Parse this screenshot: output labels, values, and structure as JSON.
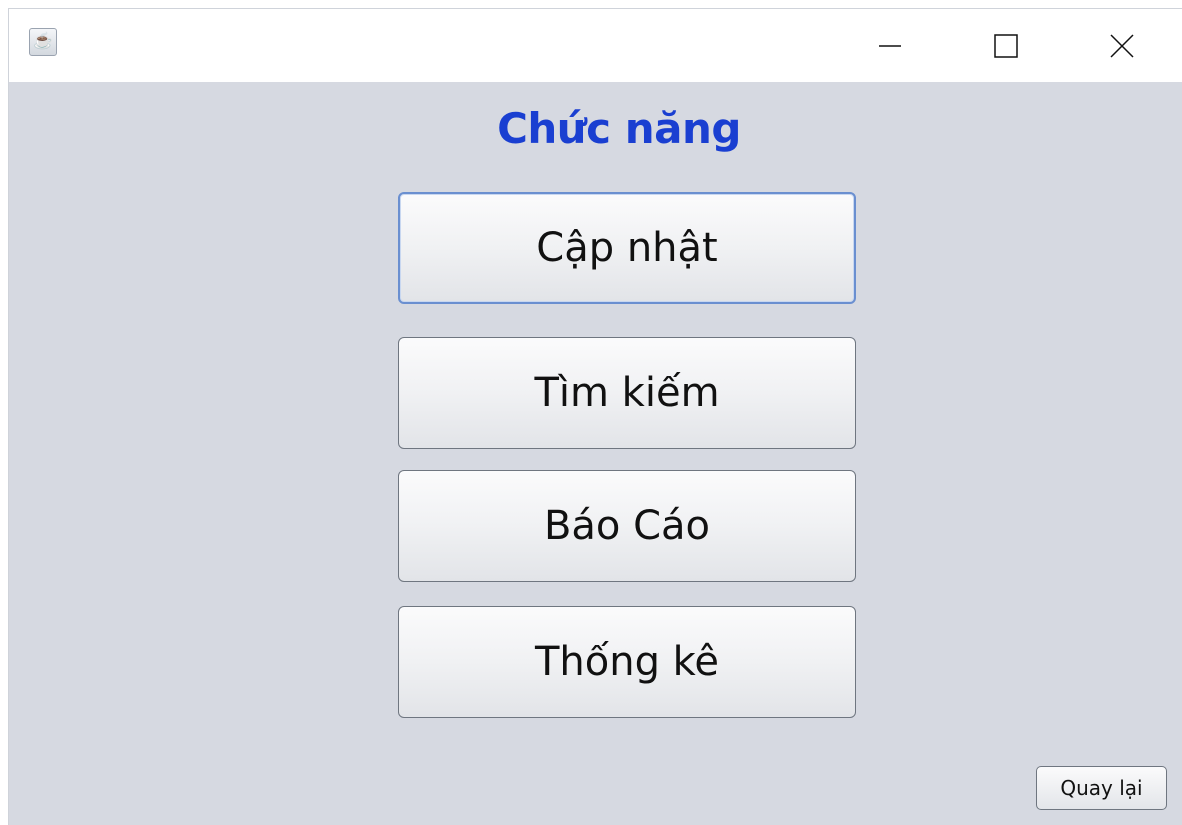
{
  "titlebar": {
    "app_icon": "java-cup-icon",
    "controls": [
      "minimize-icon",
      "maximize-icon",
      "close-icon"
    ]
  },
  "main": {
    "heading": "Chức năng",
    "heading_color": "#1a3fd1",
    "buttons": [
      {
        "label": "Cập nhật"
      },
      {
        "label": "Tìm kiếm"
      },
      {
        "label": "Báo Cáo"
      },
      {
        "label": "Thống kê"
      }
    ],
    "back_label": "Quay lại"
  }
}
